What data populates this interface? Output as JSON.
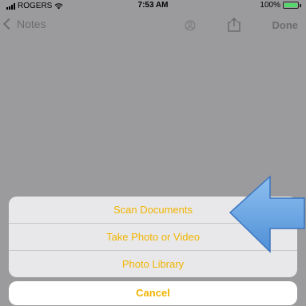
{
  "status_bar": {
    "carrier": "ROGERS",
    "time": "7:53 AM",
    "battery": "100%",
    "battery_color": "#53d86a"
  },
  "nav": {
    "back_label": "Notes",
    "done_label": "Done",
    "icons": [
      "chevron-left-icon",
      "share-person-icon",
      "share-up-icon"
    ]
  },
  "action_sheet": {
    "items": [
      "Scan Documents",
      "Take Photo or Video",
      "Photo Library"
    ],
    "cancel_label": "Cancel",
    "text_color": "#f0b400"
  },
  "annotation": {
    "arrow_color": "#6ea7e4"
  }
}
